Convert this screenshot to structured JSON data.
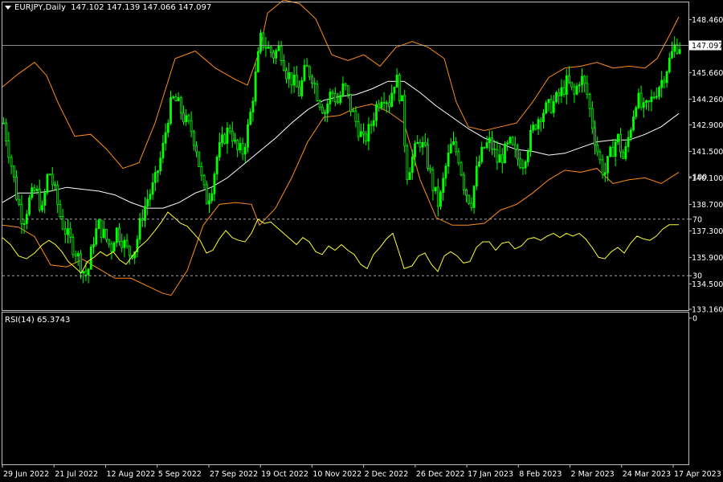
{
  "header": {
    "symbol": "EURJPY,Daily",
    "ohlc": "147.102 147.139 147.066 147.097"
  },
  "rsi": {
    "label": "RSI(14) 65.3743",
    "levels": [
      70,
      30
    ],
    "axis_labels": [
      "100",
      "70",
      "30",
      "0"
    ]
  },
  "colors": {
    "background": "#000000",
    "candle": "#00ff00",
    "bands": "#ff8c1a",
    "middle_band": "#ffffff",
    "rsi_line": "#ffff33",
    "axis_text": "#ffffff",
    "frame": "#c0c0c0"
  },
  "chart_data": {
    "type": "candlestick",
    "symbol": "EURJPY",
    "timeframe": "Daily",
    "last_price": "147.097",
    "y_ticks": [
      "148.460",
      "145.660",
      "144.260",
      "142.900",
      "141.500",
      "140.100",
      "138.700",
      "137.300",
      "135.900",
      "134.500",
      "133.160"
    ],
    "ylim": [
      133.16,
      149.4
    ],
    "x_ticks": [
      "29 Jun 2022",
      "21 Jul 2022",
      "12 Aug 2022",
      "5 Sep 2022",
      "27 Sep 2022",
      "19 Oct 2022",
      "10 Nov 2022",
      "2 Dec 2022",
      "26 Dec 2022",
      "17 Jan 2023",
      "8 Feb 2023",
      "2 Mar 2023",
      "24 Mar 2023",
      "17 Apr 2023"
    ],
    "close_path": [
      [
        0,
        143.0
      ],
      [
        8,
        141.2
      ],
      [
        16,
        139.2
      ],
      [
        24,
        137.8
      ],
      [
        32,
        138.9
      ],
      [
        40,
        139.5
      ],
      [
        48,
        138.3
      ],
      [
        56,
        140.6
      ],
      [
        64,
        139.3
      ],
      [
        72,
        137.8
      ],
      [
        80,
        137.0
      ],
      [
        90,
        136.2
      ],
      [
        98,
        135.3
      ],
      [
        104,
        134.9
      ],
      [
        112,
        136.9
      ],
      [
        118,
        137.6
      ],
      [
        126,
        137.0
      ],
      [
        134,
        136.4
      ],
      [
        140,
        137.4
      ],
      [
        148,
        136.8
      ],
      [
        156,
        136.1
      ],
      [
        164,
        136.4
      ],
      [
        172,
        138.1
      ],
      [
        180,
        139.1
      ],
      [
        188,
        139.8
      ],
      [
        198,
        141.6
      ],
      [
        206,
        143.7
      ],
      [
        212,
        144.3
      ],
      [
        218,
        143.9
      ],
      [
        226,
        143.1
      ],
      [
        234,
        142.6
      ],
      [
        240,
        141.7
      ],
      [
        246,
        140.1
      ],
      [
        252,
        138.9
      ],
      [
        258,
        139.4
      ],
      [
        266,
        141.3
      ],
      [
        274,
        142.2
      ],
      [
        282,
        142.8
      ],
      [
        290,
        141.5
      ],
      [
        298,
        141.5
      ],
      [
        306,
        143.1
      ],
      [
        314,
        145.6
      ],
      [
        320,
        147.4
      ],
      [
        328,
        147.0
      ],
      [
        336,
        146.6
      ],
      [
        344,
        147.0
      ],
      [
        352,
        145.7
      ],
      [
        360,
        145.2
      ],
      [
        368,
        144.6
      ],
      [
        376,
        145.9
      ],
      [
        384,
        145.5
      ],
      [
        392,
        144.3
      ],
      [
        400,
        143.6
      ],
      [
        408,
        144.7
      ],
      [
        416,
        144.1
      ],
      [
        424,
        145.0
      ],
      [
        432,
        143.8
      ],
      [
        440,
        142.9
      ],
      [
        448,
        142.0
      ],
      [
        456,
        142.7
      ],
      [
        464,
        143.9
      ],
      [
        472,
        144.6
      ],
      [
        480,
        144.1
      ],
      [
        488,
        145.5
      ],
      [
        496,
        144.0
      ],
      [
        502,
        140.3
      ],
      [
        510,
        141.3
      ],
      [
        518,
        142.1
      ],
      [
        526,
        141.3
      ],
      [
        534,
        139.7
      ],
      [
        542,
        138.6
      ],
      [
        550,
        140.6
      ],
      [
        558,
        141.9
      ],
      [
        566,
        141.3
      ],
      [
        574,
        139.5
      ],
      [
        582,
        138.8
      ],
      [
        590,
        140.7
      ],
      [
        598,
        141.7
      ],
      [
        606,
        142.0
      ],
      [
        614,
        141.0
      ],
      [
        622,
        141.3
      ],
      [
        630,
        141.9
      ],
      [
        638,
        141.2
      ],
      [
        646,
        140.9
      ],
      [
        654,
        142.0
      ],
      [
        662,
        143.0
      ],
      [
        670,
        143.6
      ],
      [
        678,
        143.8
      ],
      [
        686,
        144.1
      ],
      [
        694,
        144.6
      ],
      [
        702,
        145.2
      ],
      [
        710,
        144.4
      ],
      [
        718,
        145.5
      ],
      [
        726,
        144.6
      ],
      [
        734,
        142.6
      ],
      [
        742,
        141.0
      ],
      [
        748,
        140.3
      ],
      [
        756,
        141.4
      ],
      [
        764,
        142.3
      ],
      [
        772,
        141.0
      ],
      [
        780,
        142.7
      ],
      [
        788,
        144.4
      ],
      [
        796,
        143.6
      ],
      [
        804,
        144.0
      ],
      [
        812,
        144.7
      ],
      [
        820,
        145.3
      ],
      [
        828,
        146.2
      ],
      [
        836,
        147.1
      ],
      [
        842,
        147.1
      ]
    ],
    "upper_band_path": [
      [
        0,
        144.9
      ],
      [
        20,
        145.6
      ],
      [
        40,
        146.2
      ],
      [
        55,
        145.5
      ],
      [
        70,
        144.0
      ],
      [
        90,
        142.3
      ],
      [
        110,
        142.4
      ],
      [
        130,
        141.6
      ],
      [
        150,
        140.6
      ],
      [
        170,
        140.9
      ],
      [
        190,
        143.0
      ],
      [
        215,
        146.4
      ],
      [
        240,
        146.8
      ],
      [
        265,
        145.9
      ],
      [
        290,
        145.3
      ],
      [
        305,
        145.0
      ],
      [
        320,
        146.8
      ],
      [
        330,
        148.8
      ],
      [
        350,
        149.5
      ],
      [
        370,
        149.3
      ],
      [
        390,
        148.5
      ],
      [
        410,
        146.6
      ],
      [
        430,
        146.3
      ],
      [
        450,
        146.6
      ],
      [
        470,
        146.0
      ],
      [
        490,
        147.0
      ],
      [
        510,
        147.3
      ],
      [
        530,
        147.0
      ],
      [
        550,
        146.4
      ],
      [
        565,
        144.1
      ],
      [
        580,
        142.8
      ],
      [
        600,
        142.6
      ],
      [
        620,
        142.8
      ],
      [
        640,
        143.0
      ],
      [
        660,
        144.1
      ],
      [
        680,
        145.4
      ],
      [
        700,
        145.9
      ],
      [
        720,
        146.0
      ],
      [
        740,
        146.2
      ],
      [
        760,
        145.9
      ],
      [
        780,
        146.0
      ],
      [
        800,
        145.9
      ],
      [
        815,
        146.4
      ],
      [
        830,
        147.6
      ],
      [
        842,
        148.6
      ]
    ],
    "middle_band_path": [
      [
        0,
        138.8
      ],
      [
        20,
        139.3
      ],
      [
        40,
        139.3
      ],
      [
        60,
        139.4
      ],
      [
        80,
        139.6
      ],
      [
        100,
        139.5
      ],
      [
        120,
        139.4
      ],
      [
        140,
        139.2
      ],
      [
        160,
        138.8
      ],
      [
        180,
        138.5
      ],
      [
        200,
        138.5
      ],
      [
        220,
        138.8
      ],
      [
        240,
        139.3
      ],
      [
        260,
        139.6
      ],
      [
        280,
        140.1
      ],
      [
        300,
        140.8
      ],
      [
        320,
        141.5
      ],
      [
        340,
        142.2
      ],
      [
        360,
        143.0
      ],
      [
        380,
        143.7
      ],
      [
        400,
        144.2
      ],
      [
        420,
        144.4
      ],
      [
        440,
        144.5
      ],
      [
        460,
        144.8
      ],
      [
        480,
        145.2
      ],
      [
        500,
        145.2
      ],
      [
        520,
        144.6
      ],
      [
        540,
        143.9
      ],
      [
        560,
        143.3
      ],
      [
        580,
        142.7
      ],
      [
        600,
        142.2
      ],
      [
        620,
        141.9
      ],
      [
        640,
        141.6
      ],
      [
        660,
        141.5
      ],
      [
        680,
        141.3
      ],
      [
        700,
        141.4
      ],
      [
        720,
        141.7
      ],
      [
        740,
        142.0
      ],
      [
        760,
        142.1
      ],
      [
        780,
        142.1
      ],
      [
        800,
        142.4
      ],
      [
        820,
        142.8
      ],
      [
        842,
        143.5
      ]
    ],
    "lower_band_path": [
      [
        0,
        137.6
      ],
      [
        20,
        137.5
      ],
      [
        40,
        137.0
      ],
      [
        60,
        135.5
      ],
      [
        80,
        135.4
      ],
      [
        100,
        135.8
      ],
      [
        120,
        135.3
      ],
      [
        140,
        134.8
      ],
      [
        160,
        134.8
      ],
      [
        180,
        134.4
      ],
      [
        200,
        134.0
      ],
      [
        210,
        133.9
      ],
      [
        230,
        135.2
      ],
      [
        250,
        137.6
      ],
      [
        270,
        138.7
      ],
      [
        290,
        138.8
      ],
      [
        310,
        138.7
      ],
      [
        320,
        137.6
      ],
      [
        340,
        138.5
      ],
      [
        360,
        140.1
      ],
      [
        380,
        142.0
      ],
      [
        400,
        143.3
      ],
      [
        420,
        143.4
      ],
      [
        440,
        143.8
      ],
      [
        460,
        144.0
      ],
      [
        480,
        143.6
      ],
      [
        500,
        143.0
      ],
      [
        520,
        140.0
      ],
      [
        540,
        138.0
      ],
      [
        560,
        137.6
      ],
      [
        580,
        137.6
      ],
      [
        600,
        137.7
      ],
      [
        620,
        138.4
      ],
      [
        640,
        138.7
      ],
      [
        660,
        139.3
      ],
      [
        680,
        140.0
      ],
      [
        700,
        140.5
      ],
      [
        720,
        140.4
      ],
      [
        740,
        140.6
      ],
      [
        760,
        139.8
      ],
      [
        780,
        140.0
      ],
      [
        800,
        140.1
      ],
      [
        820,
        139.8
      ],
      [
        842,
        140.4
      ]
    ],
    "rsi_path": [
      [
        0,
        57
      ],
      [
        10,
        52
      ],
      [
        20,
        44
      ],
      [
        30,
        42
      ],
      [
        40,
        46
      ],
      [
        50,
        52
      ],
      [
        58,
        55
      ],
      [
        66,
        52
      ],
      [
        74,
        47
      ],
      [
        82,
        40
      ],
      [
        90,
        36
      ],
      [
        98,
        32
      ],
      [
        106,
        40
      ],
      [
        114,
        43
      ],
      [
        122,
        47
      ],
      [
        130,
        44
      ],
      [
        138,
        47
      ],
      [
        146,
        41
      ],
      [
        154,
        38
      ],
      [
        162,
        44
      ],
      [
        170,
        50
      ],
      [
        180,
        55
      ],
      [
        190,
        62
      ],
      [
        198,
        68
      ],
      [
        206,
        75
      ],
      [
        214,
        71
      ],
      [
        222,
        67
      ],
      [
        230,
        65
      ],
      [
        238,
        60
      ],
      [
        246,
        55
      ],
      [
        254,
        46
      ],
      [
        262,
        48
      ],
      [
        270,
        56
      ],
      [
        278,
        62
      ],
      [
        286,
        57
      ],
      [
        294,
        55
      ],
      [
        302,
        54
      ],
      [
        310,
        60
      ],
      [
        318,
        70
      ],
      [
        326,
        67
      ],
      [
        334,
        68
      ],
      [
        342,
        64
      ],
      [
        350,
        60
      ],
      [
        358,
        56
      ],
      [
        366,
        52
      ],
      [
        374,
        57
      ],
      [
        382,
        54
      ],
      [
        390,
        47
      ],
      [
        398,
        45
      ],
      [
        406,
        51
      ],
      [
        414,
        48
      ],
      [
        422,
        52
      ],
      [
        430,
        48
      ],
      [
        438,
        45
      ],
      [
        446,
        38
      ],
      [
        454,
        35
      ],
      [
        462,
        45
      ],
      [
        470,
        50
      ],
      [
        478,
        56
      ],
      [
        486,
        60
      ],
      [
        494,
        46
      ],
      [
        500,
        35
      ],
      [
        510,
        37
      ],
      [
        518,
        44
      ],
      [
        526,
        46
      ],
      [
        534,
        38
      ],
      [
        542,
        33
      ],
      [
        550,
        44
      ],
      [
        558,
        47
      ],
      [
        566,
        44
      ],
      [
        574,
        39
      ],
      [
        582,
        40
      ],
      [
        590,
        50
      ],
      [
        598,
        54
      ],
      [
        606,
        54
      ],
      [
        614,
        48
      ],
      [
        622,
        53
      ],
      [
        630,
        54
      ],
      [
        638,
        49
      ],
      [
        646,
        51
      ],
      [
        654,
        56
      ],
      [
        662,
        57
      ],
      [
        670,
        55
      ],
      [
        678,
        58
      ],
      [
        686,
        60
      ],
      [
        694,
        57
      ],
      [
        702,
        60
      ],
      [
        710,
        58
      ],
      [
        718,
        60
      ],
      [
        726,
        56
      ],
      [
        734,
        50
      ],
      [
        742,
        43
      ],
      [
        750,
        42
      ],
      [
        758,
        47
      ],
      [
        766,
        50
      ],
      [
        774,
        46
      ],
      [
        782,
        53
      ],
      [
        790,
        58
      ],
      [
        798,
        56
      ],
      [
        806,
        55
      ],
      [
        814,
        58
      ],
      [
        822,
        63
      ],
      [
        830,
        66
      ],
      [
        836,
        66
      ],
      [
        842,
        66
      ]
    ]
  }
}
